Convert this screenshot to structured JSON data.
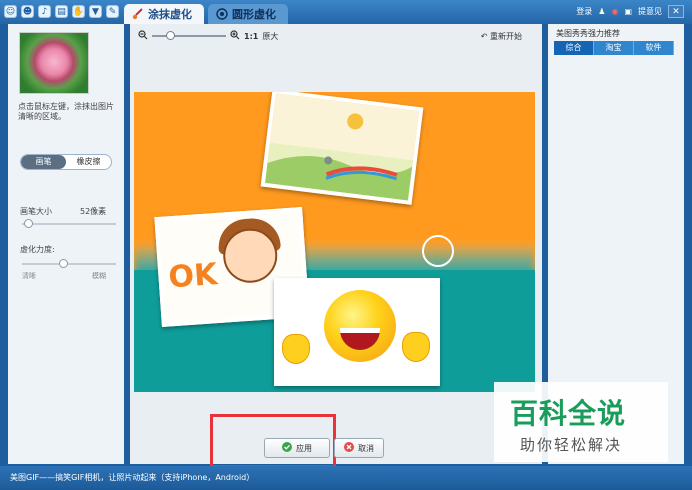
{
  "topbar": {
    "tabs": [
      {
        "label": "涂抹虚化",
        "active": true
      },
      {
        "label": "圆形虚化",
        "active": false
      }
    ],
    "login_label": "登录",
    "suggest_label": "提意见"
  },
  "left_panel": {
    "hint": "点击鼠标左键，涂抹出图片清晰的区域。",
    "modes": [
      "画笔",
      "橡皮擦"
    ],
    "brush_size_label": "画笔大小",
    "brush_size_value": "52像素",
    "brush_size_level": 0.06,
    "blur_label": "虚化力度:",
    "blur_min_label": "清晰",
    "blur_max_label": "模糊",
    "blur_level": 0.44
  },
  "canvas_toolbar": {
    "zoom_text": "1:1",
    "original_label": "原大",
    "reset_label": "重新开始"
  },
  "actions": {
    "apply_label": "应用",
    "cancel_label": "取消"
  },
  "right_panel": {
    "title": "美图秀秀强力推荐",
    "tabs": [
      "综合",
      "淘宝",
      "软件"
    ]
  },
  "status_bar": {
    "text": "美图GIF——搞笑GIF相机，让照片动起来（支持iPhone，Android）"
  },
  "watermark": {
    "title": "百科全说",
    "subtitle": "助你轻松解决"
  },
  "canvas_text": {
    "ok": "OK"
  }
}
